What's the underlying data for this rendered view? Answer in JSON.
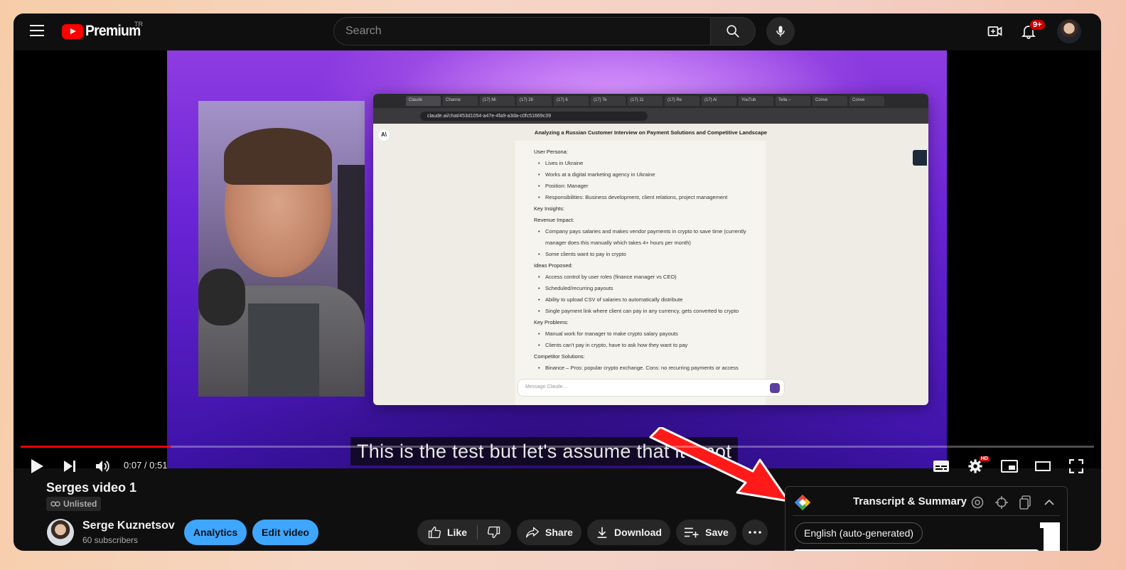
{
  "header": {
    "logo_text": "Premium",
    "country_code": "TR",
    "search_placeholder": "Search",
    "notification_count": "9+"
  },
  "player": {
    "caption": "This is the test but let's assume that it's not",
    "current_time": "0:07",
    "duration": "0:51",
    "time_display": "0:07 / 0:51",
    "progress_fraction": 0.14,
    "quality_badge": "HD"
  },
  "screen_content": {
    "browser_url": "claude.ai/chat/453d1054-a47e-4fa9-a3da-c0fc51669c39",
    "tabs": [
      "Claude",
      "Channe",
      "(17) Mi",
      "(17) 28",
      "(17) 6",
      "(17) Te",
      "(17) 11",
      "(17) Re",
      "(17) Ai",
      "YouTub",
      "Tella –",
      "Conve",
      "Conve"
    ],
    "chat_title": "Analyzing a Russian Customer Interview on Payment Solutions and Competitive Landscape",
    "lines": [
      {
        "type": "sec",
        "text": "User Persona:"
      },
      {
        "type": "it",
        "text": "Lives in Ukraine"
      },
      {
        "type": "it",
        "text": "Works at a digital marketing agency in Ukraine"
      },
      {
        "type": "it",
        "text": "Position: Manager"
      },
      {
        "type": "it",
        "text": "Responsibilities: Business development, client relations, project management"
      },
      {
        "type": "sec",
        "text": "Key Insights:"
      },
      {
        "type": "sec",
        "text": "Revenue Impact:"
      },
      {
        "type": "it",
        "text": "Company pays salaries and makes vendor payments in crypto to save time (currently manager does this manually which takes 4+ hours per month)"
      },
      {
        "type": "it",
        "text": "Some clients want to pay in crypto"
      },
      {
        "type": "sec",
        "text": "Ideas Proposed:"
      },
      {
        "type": "it",
        "text": "Access control by user roles (finance manager vs CEO)"
      },
      {
        "type": "it",
        "text": "Scheduled/recurring payouts"
      },
      {
        "type": "it",
        "text": "Ability to upload CSV of salaries to automatically distribute"
      },
      {
        "type": "it",
        "text": "Single payment link where client can pay in any currency, gets converted to crypto"
      },
      {
        "type": "sec",
        "text": "Key Problems:"
      },
      {
        "type": "it",
        "text": "Manual work for manager to make crypto salary payouts"
      },
      {
        "type": "it",
        "text": "Clients can't pay in crypto, have to ask how they want to pay"
      },
      {
        "type": "sec",
        "text": "Competitor Solutions:"
      },
      {
        "type": "it",
        "text": "Binance – Pros: popular crypto exchange. Cons: no recurring payments or access"
      }
    ],
    "message_placeholder": "Message Claude..."
  },
  "video": {
    "title": "Serges video 1",
    "visibility": "Unlisted"
  },
  "channel": {
    "name": "Serge Kuznetsov",
    "subscribers": "60 subscribers"
  },
  "actions": {
    "analytics": "Analytics",
    "edit_video": "Edit video",
    "like": "Like",
    "share": "Share",
    "download": "Download",
    "save": "Save"
  },
  "extension": {
    "title": "Transcript & Summary",
    "language": "English (auto-generated)"
  },
  "colors": {
    "brand_red": "#ff0000",
    "accent_blue": "#3ea6ff",
    "annotation_arrow": "#ff1a1a"
  }
}
